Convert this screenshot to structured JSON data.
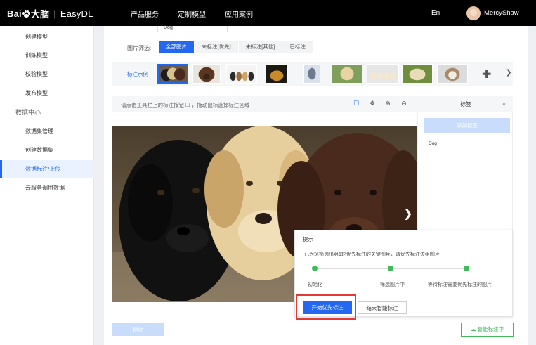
{
  "header": {
    "brand_prefix": "Bai",
    "brand_cn": "大脑",
    "product": "EasyDL",
    "nav": [
      "产品服务",
      "定制模型",
      "应用案例"
    ],
    "lang": "En",
    "username": "MercyShaw"
  },
  "sidebar": {
    "items_top": [
      "创建模型",
      "训练模型",
      "校验模型",
      "发布模型"
    ],
    "group_label": "数据中心",
    "items_data": [
      "数据集管理",
      "创建数据集",
      "数据标注/上传",
      "云服务调用数据"
    ],
    "active_item": "数据标注/上传"
  },
  "main": {
    "dataset_name_value": "Dog",
    "filter_label": "图片筛选:",
    "tabs": [
      "全部图片",
      "未标注[优先]",
      "未标注[其他]",
      "已标注"
    ],
    "strip_label": "标注示例",
    "toolbar_hint": "请点击工具栏上的标注按钮",
    "toolbar_hint_tail": "，拖动鼠标选择标注区域",
    "label_panel_title": "标签",
    "add_label_button": "添加标签",
    "labels": [
      "Dog"
    ]
  },
  "dialog": {
    "title": "提示",
    "message": "已为您筛选出第1轮优先标注的关键图片，请优先标注该组图片",
    "steps": [
      "初始化",
      "筛选图片中",
      "等待标注需要优先标注的图片"
    ],
    "primary_button": "开始优先标注",
    "secondary_button": "结束智能标注"
  },
  "footer": {
    "save_button": "保存",
    "smart_button": "智能标注中"
  },
  "colors": {
    "accent": "#2468f2",
    "success": "#3fbb5b",
    "highlight": "#e53935"
  }
}
